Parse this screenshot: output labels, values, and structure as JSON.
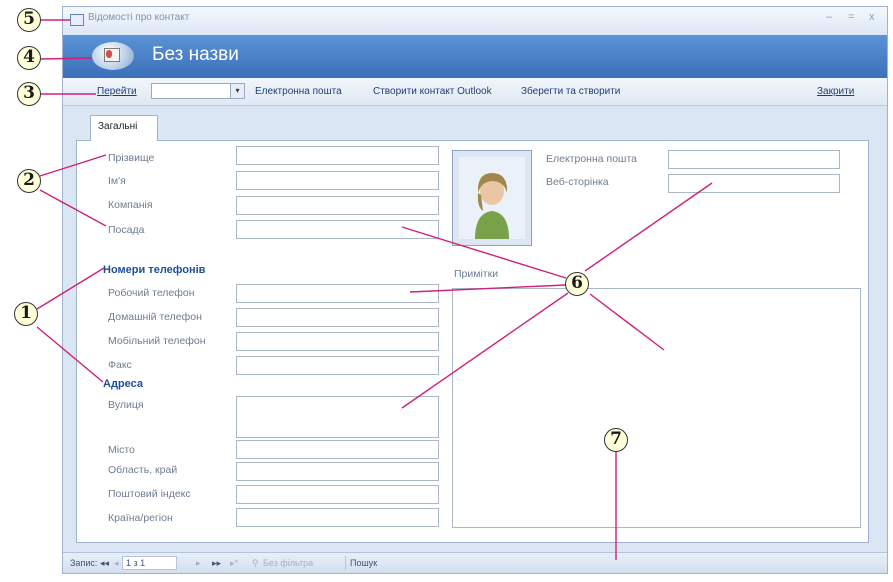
{
  "window": {
    "title": "Відомості про контакт",
    "minimize_glyph": "–",
    "maximize_glyph": "=",
    "close_glyph": "x",
    "title_icon": "form-icon"
  },
  "header": {
    "title": "Без назви",
    "icon": "contact-card-icon"
  },
  "toolbar": {
    "go_label": "Перейти",
    "go_value": "",
    "email_label": "Електронна пошта",
    "create_outlook_label": "Створити контакт Outlook",
    "save_new_label": "Зберегти та створити",
    "close_label": "Закрити"
  },
  "tabs": [
    {
      "label": "Загальні",
      "selected": true
    }
  ],
  "form": {
    "last_name_label": "Прізвище",
    "first_name_label": "Ім'я",
    "company_label": "Компанія",
    "job_title_label": "Посада",
    "phones_header": "Номери телефонів",
    "work_phone_label": "Робочий телефон",
    "home_phone_label": "Домашній телефон",
    "mobile_phone_label": "Мобільний телефон",
    "fax_label": "Факс",
    "address_header": "Адреса",
    "street_label": "Вулиця",
    "city_label": "Місто",
    "region_label": "Область, край",
    "postal_label": "Поштовий індекс",
    "country_label": "Країна/регіон",
    "email_label": "Електронна пошта",
    "web_label": "Веб-сторінка",
    "notes_label": "Примітки"
  },
  "statusbar": {
    "record_label": "Запис:",
    "first_glyph": "◂◂",
    "prev_glyph": "◂",
    "record_position": "1 з 1",
    "next_glyph": "▸",
    "last_glyph": "▸▸",
    "new_glyph": "▸*",
    "filter_label": "Без фільтра",
    "search_label": "Пошук"
  },
  "callouts": [
    "1",
    "2",
    "3",
    "4",
    "5",
    "6",
    "7"
  ],
  "colors": {
    "header_blue": "#3a70b9",
    "callout_line": "#d0207a",
    "header_text": "#1f4f9a"
  }
}
